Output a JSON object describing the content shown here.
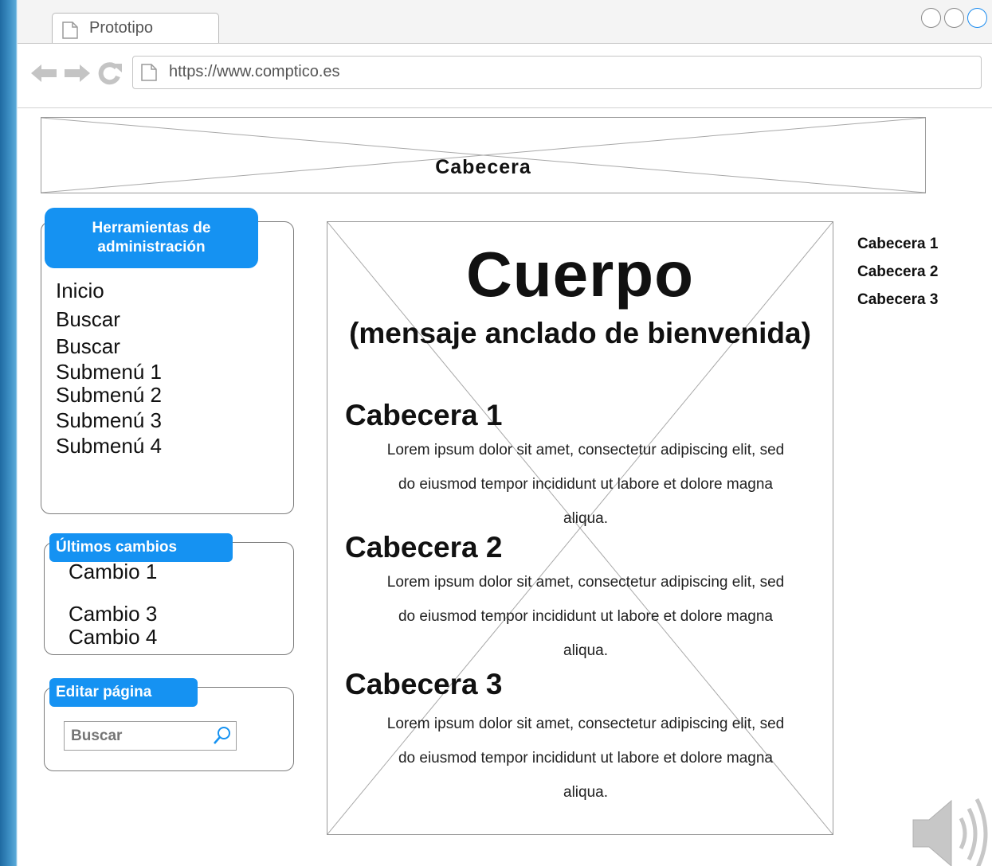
{
  "browser": {
    "tab_title": "Prototipo",
    "url": "https://www.comptico.es",
    "nav_icons": [
      "back-arrow-icon",
      "forward-arrow-icon",
      "reload-icon"
    ]
  },
  "header": {
    "label": "Cabecera"
  },
  "admin_panel": {
    "title": "Herramientas de administración",
    "items": [
      "Inicio",
      "Buscar",
      "Buscar",
      "Submenú 1",
      "Submenú 2",
      "Submenú 3",
      "Submenú 4"
    ]
  },
  "changes_panel": {
    "title": "Últimos cambios",
    "items": [
      "Cambio 1",
      "Cambio 3",
      "Cambio 4"
    ]
  },
  "edit_panel": {
    "title": "Editar página",
    "search_placeholder": "Buscar"
  },
  "body": {
    "title": "Cuerpo",
    "subtitle": "(mensaje anclado de bienvenida)",
    "sections": [
      {
        "heading": "Cabecera 1",
        "text": "Lorem ipsum dolor sit amet, consectetur adipiscing elit, sed do eiusmod tempor incididunt ut labore et dolore magna aliqua."
      },
      {
        "heading": "Cabecera 2",
        "text": "Lorem ipsum dolor sit amet, consectetur adipiscing elit, sed do eiusmod tempor incididunt ut labore et dolore magna aliqua."
      },
      {
        "heading": "Cabecera 3",
        "text": "Lorem ipsum dolor sit amet, consectetur adipiscing elit, sed do eiusmod tempor incididunt ut labore et dolore magna aliqua."
      }
    ]
  },
  "toc": {
    "items": [
      "Cabecera 1",
      "Cabecera 2",
      "Cabecera 3"
    ]
  },
  "colors": {
    "accent": "#1592f2",
    "border": "#7c7c7c"
  }
}
